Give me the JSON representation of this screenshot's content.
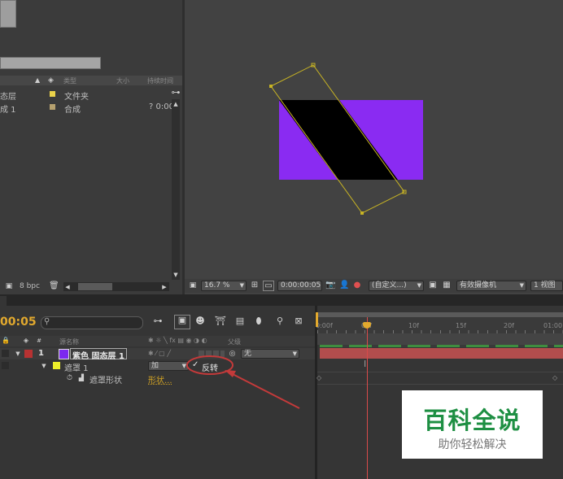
{
  "project": {
    "columns": {
      "type": "类型",
      "size": "大小",
      "duration": "持续时间"
    },
    "items": [
      {
        "name": "态层",
        "type": "文件夹",
        "size": "",
        "duration": "",
        "color": "#ead24a"
      },
      {
        "name": "成 1",
        "type": "合成",
        "size": "",
        "duration": "? 0:00",
        "color": "#b6a16f"
      }
    ],
    "bpc": "8 bpc"
  },
  "viewer": {
    "zoom": "16.7 %",
    "timecode": "0:00:00:05",
    "resolution": "(自定义...)",
    "camera": "有效摄像机",
    "views": "1 视图",
    "solid_color": "#8a2bf2",
    "mask_color": "#c8b424"
  },
  "timeline": {
    "current_time": "00:05",
    "search_placeholder": "",
    "columns": {
      "source": "源名称",
      "parent": "父级"
    },
    "layer": {
      "index": "1",
      "name": "紫色 固态层 1",
      "color": "#7c28f0",
      "parent": "无"
    },
    "mask": {
      "name": "遮罩 1",
      "mode": "加",
      "invert_label": "反转"
    },
    "mask_path": {
      "name": "遮罩形状",
      "value": "形状..."
    },
    "ruler": [
      "0:00f",
      "05f",
      "10f",
      "15f",
      "20f",
      "01:00"
    ]
  },
  "watermark": {
    "title": "百科全说",
    "subtitle": "助你轻松解决"
  }
}
